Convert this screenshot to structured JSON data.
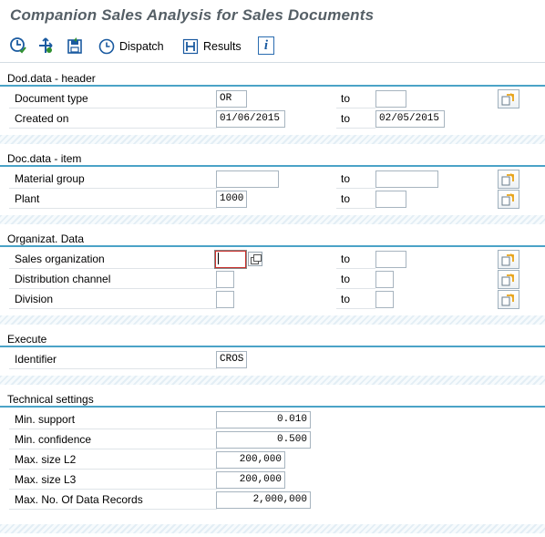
{
  "title": "Companion Sales Analysis for Sales Documents",
  "toolbar": {
    "dispatch_label": "Dispatch",
    "results_label": "Results"
  },
  "sections": {
    "header": {
      "title": "Dod.data - header",
      "document_type": {
        "label": "Document type",
        "from": "OR",
        "to_label": "to",
        "to": ""
      },
      "created_on": {
        "label": "Created on",
        "from": "01/06/2015",
        "to_label": "to",
        "to": "02/05/2015"
      }
    },
    "item": {
      "title": "Doc.data - item",
      "material_group": {
        "label": "Material group",
        "from": "",
        "to_label": "to",
        "to": ""
      },
      "plant": {
        "label": "Plant",
        "from": "1000",
        "to_label": "to",
        "to": ""
      }
    },
    "org": {
      "title": "Organizat. Data",
      "sales_org": {
        "label": "Sales organization",
        "from": "",
        "to_label": "to",
        "to": ""
      },
      "dist_channel": {
        "label": "Distribution channel",
        "from": "",
        "to_label": "to",
        "to": ""
      },
      "division": {
        "label": "Division",
        "from": "",
        "to_label": "to",
        "to": ""
      }
    },
    "execute": {
      "title": "Execute",
      "identifier": {
        "label": "Identifier",
        "value": "CROS"
      }
    },
    "technical": {
      "title": "Technical settings",
      "min_support": {
        "label": "Min. support",
        "value": "0.010"
      },
      "min_confidence": {
        "label": "Min. confidence",
        "value": "0.500"
      },
      "max_l2": {
        "label": "Max. size L2",
        "value": "200,000"
      },
      "max_l3": {
        "label": "Max. size L3",
        "value": "200,000"
      },
      "max_records": {
        "label": "Max. No. Of Data Records",
        "value": "2,000,000"
      }
    }
  }
}
